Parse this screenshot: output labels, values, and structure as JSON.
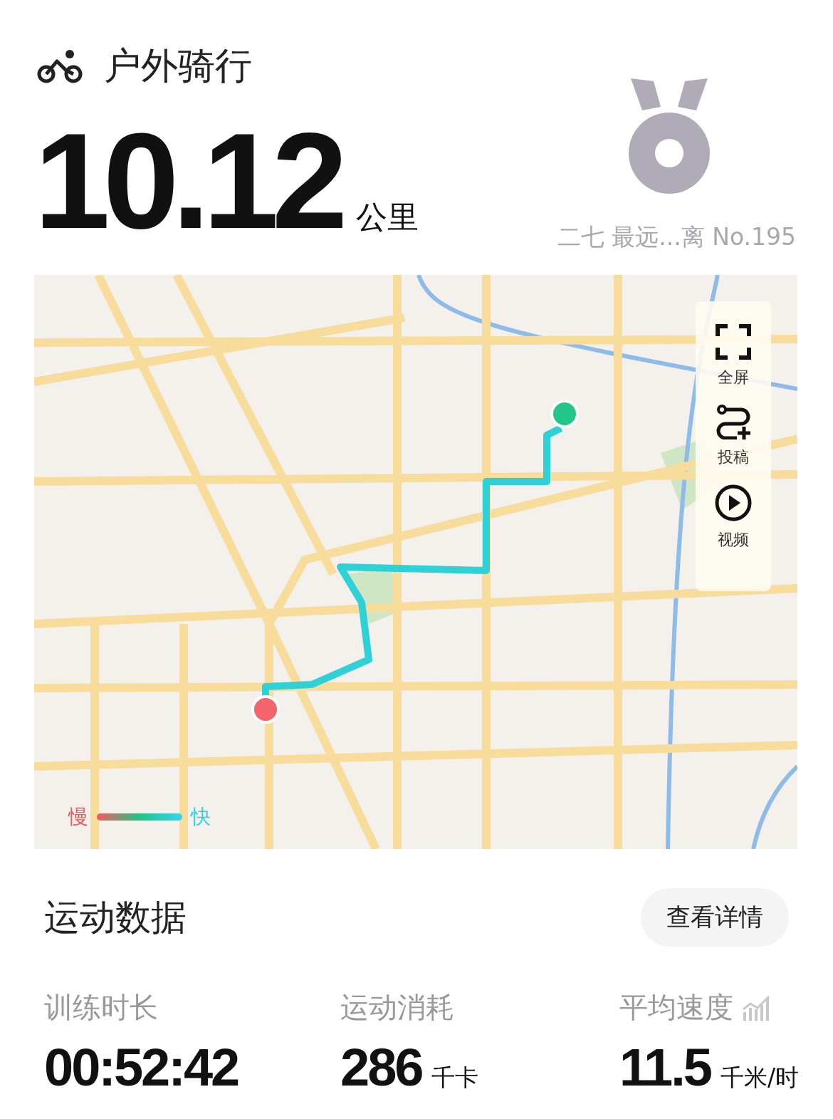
{
  "title": "户外骑行",
  "distance": {
    "value": "10.12",
    "unit": "公里"
  },
  "medal": {
    "caption": "二七 最远...离 No.195"
  },
  "map": {
    "kind": "picture",
    "tools": [
      {
        "label": "全屏"
      },
      {
        "label": "投稿"
      },
      {
        "label": "视频"
      }
    ],
    "legend": {
      "slow": "慢",
      "fast": "快"
    }
  },
  "section": {
    "title": "运动数据",
    "button": "查看详情"
  },
  "stats": [
    {
      "kind": "plain",
      "label": "训练时长",
      "value": "00:52:42"
    },
    {
      "kind": "plain",
      "label": "运动消耗",
      "value": "286",
      "unit": "千卡"
    },
    {
      "kind": "trend",
      "label": "平均速度",
      "value": "11.5",
      "unit": "千米/时"
    }
  ]
}
